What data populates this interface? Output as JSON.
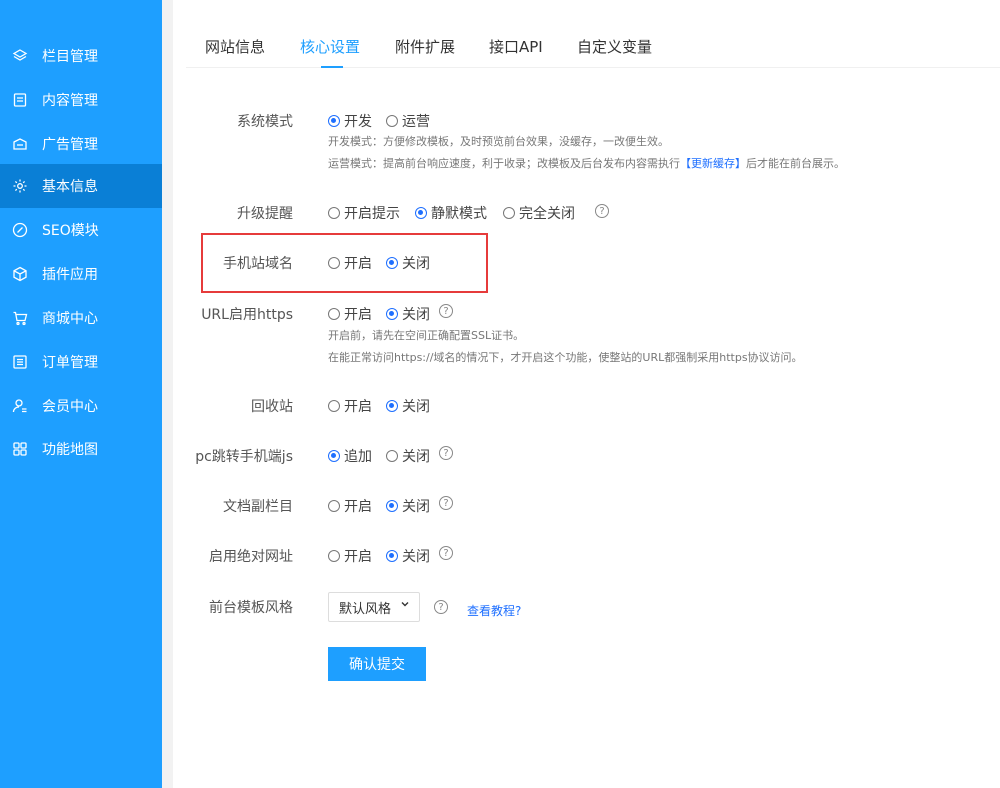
{
  "sidebar": {
    "items": [
      {
        "label": "栏目管理",
        "icon": "layers-icon"
      },
      {
        "label": "内容管理",
        "icon": "document-icon"
      },
      {
        "label": "广告管理",
        "icon": "megaphone-icon"
      },
      {
        "label": "基本信息",
        "icon": "gear-icon",
        "active": true
      },
      {
        "label": "SEO模块",
        "icon": "link-icon"
      },
      {
        "label": "插件应用",
        "icon": "cube-icon"
      },
      {
        "label": "商城中心",
        "icon": "cart-icon"
      },
      {
        "label": "订单管理",
        "icon": "list-icon"
      },
      {
        "label": "会员中心",
        "icon": "user-icon"
      },
      {
        "label": "功能地图",
        "icon": "grid-icon"
      }
    ]
  },
  "tabs": [
    {
      "label": "网站信息"
    },
    {
      "label": "核心设置",
      "active": true
    },
    {
      "label": "附件扩展"
    },
    {
      "label": "接口API"
    },
    {
      "label": "自定义变量"
    }
  ],
  "form": {
    "system_mode": {
      "label": "系统模式",
      "options": [
        "开发",
        "运营"
      ],
      "selected": "开发",
      "hint1": "开发模式：方便修改模板，及时预览前台效果，没缓存，一改便生效。",
      "hint2_prefix": "运营模式：提高前台响应速度，利于收录；改模板及后台发布内容需执行",
      "hint2_em": "【更新缓存】",
      "hint2_suffix": "后才能在前台展示。"
    },
    "upgrade_notice": {
      "label": "升级提醒",
      "options": [
        "开启提示",
        "静默模式",
        "完全关闭"
      ],
      "selected": "静默模式"
    },
    "mobile_domain": {
      "label": "手机站域名",
      "options": [
        "开启",
        "关闭"
      ],
      "selected": "关闭"
    },
    "url_https": {
      "label": "URL启用https",
      "options": [
        "开启",
        "关闭"
      ],
      "selected": "关闭",
      "hint1": "开启前，请先在空间正确配置SSL证书。",
      "hint2": "在能正常访问https://域名的情况下，才开启这个功能，使整站的URL都强制采用https协议访问。"
    },
    "recycle_bin": {
      "label": "回收站",
      "options": [
        "开启",
        "关闭"
      ],
      "selected": "关闭"
    },
    "pc_redirect_js": {
      "label": "pc跳转手机端js",
      "options": [
        "追加",
        "关闭"
      ],
      "selected": "追加"
    },
    "doc_subcolumn": {
      "label": "文档副栏目",
      "options": [
        "开启",
        "关闭"
      ],
      "selected": "关闭"
    },
    "absolute_url": {
      "label": "启用绝对网址",
      "options": [
        "开启",
        "关闭"
      ],
      "selected": "关闭"
    },
    "template_style": {
      "label": "前台模板风格",
      "value": "默认风格",
      "link": "查看教程?"
    },
    "help_glyph": "?",
    "submit_label": "确认提交"
  },
  "colors": {
    "sidebar_bg": "#1e9fff",
    "sidebar_active": "#0a7fd6",
    "accent": "#1e6fff",
    "highlight_border": "#e63b3b"
  }
}
